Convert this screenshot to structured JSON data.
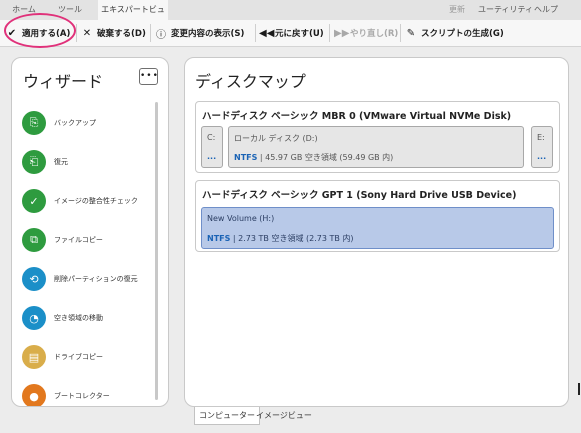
{
  "menu": {
    "tabs": [
      "ホーム",
      "ツール",
      "エキスパートビュー"
    ],
    "active_tab": 2,
    "right": {
      "update": "更新",
      "utility": "ユーティリティ",
      "help": "ヘルプ"
    }
  },
  "toolbar": {
    "apply": "適用する(A)",
    "discard": "破棄する(D)",
    "show_changes": "変更内容の表示(S)",
    "undo": "元に戻す(U)",
    "redo": "やり直し(R)",
    "script": "スクリプトの生成(G)"
  },
  "wizard": {
    "title": "ウィザード",
    "more": "•••",
    "items": [
      {
        "label": "バックアップ",
        "icon": "backup-icon",
        "color": "#2e9b3f",
        "glyph": "⎘"
      },
      {
        "label": "復元",
        "icon": "restore-icon",
        "color": "#2e9b3f",
        "glyph": "⎗"
      },
      {
        "label": "イメージの整合性チェック",
        "icon": "check-integrity-icon",
        "color": "#2e9b3f",
        "glyph": "✓"
      },
      {
        "label": "ファイルコピー",
        "icon": "file-copy-icon",
        "color": "#2e9b3f",
        "glyph": "⧉"
      },
      {
        "label": "削除パーティションの復元",
        "icon": "recover-partition-icon",
        "color": "#1b8fc8",
        "glyph": "⟲"
      },
      {
        "label": "空き領域の移動",
        "icon": "move-free-space-icon",
        "color": "#1b8fc8",
        "glyph": "◔"
      },
      {
        "label": "ドライブコピー",
        "icon": "drive-copy-icon",
        "color": "#d9ad4a",
        "glyph": "▤"
      },
      {
        "label": "ブートコレクター",
        "icon": "boot-corrector-icon",
        "color": "#e2781e",
        "glyph": "●"
      }
    ]
  },
  "diskmap": {
    "title": "ディスクマップ",
    "disks": [
      {
        "name": "ハードディスク ベーシック MBR 0 (VMware Virtual NVMe Disk)",
        "partitions": [
          {
            "label": "C:",
            "dots": "..."
          },
          {
            "label": "ローカル ディスク (D:)",
            "fs": "NTFS",
            "info": " | 45.97 GB 空き領域 (59.49 GB 内)"
          },
          {
            "label": "E:",
            "dots": "..."
          }
        ]
      },
      {
        "name": "ハードディスク ベーシック GPT 1 (Sony Hard Drive USB Device)",
        "partitions": [
          {
            "label": "New Volume (H:)",
            "fs": "NTFS",
            "info": " | 2.73 TB 空き領域 (2.73 TB 内)"
          }
        ]
      }
    ]
  },
  "bottom_tabs": [
    "コンピューター",
    "イメージビュー"
  ]
}
